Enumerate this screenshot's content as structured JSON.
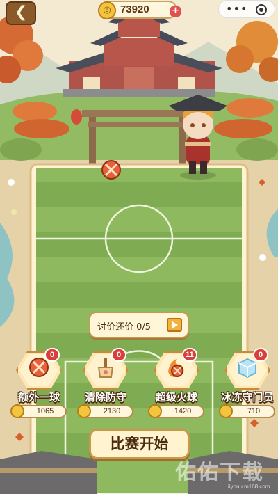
{
  "hud": {
    "back_icon": "arrow-left-icon",
    "coins": "73920",
    "coin_icon": "coin-icon",
    "add_icon": "plus-icon",
    "window_more": "•••",
    "window_close_icon": "close-circle-icon"
  },
  "bargain": {
    "label": "讨价还价 0/5",
    "icon": "video-play-icon"
  },
  "items": [
    {
      "name": "额外一球",
      "price": "1065",
      "count": "0",
      "icon": "ball-icon"
    },
    {
      "name": "清除防守",
      "price": "2130",
      "count": "0",
      "icon": "broom-icon"
    },
    {
      "name": "超级火球",
      "price": "1420",
      "count": "11",
      "icon": "fireball-icon"
    },
    {
      "name": "冰冻守门员",
      "price": "710",
      "count": "0",
      "icon": "ice-cube-icon"
    }
  ],
  "start_button": "比赛开始",
  "watermark": {
    "text": "佑佑下载",
    "url": "iiyouu.m168.com"
  },
  "colors": {
    "field_light": "#8fb95f",
    "field_dark": "#7fab52",
    "sand": "#e6d2a8",
    "accent_gold": "#c99848",
    "badge_red": "#d9403a"
  }
}
